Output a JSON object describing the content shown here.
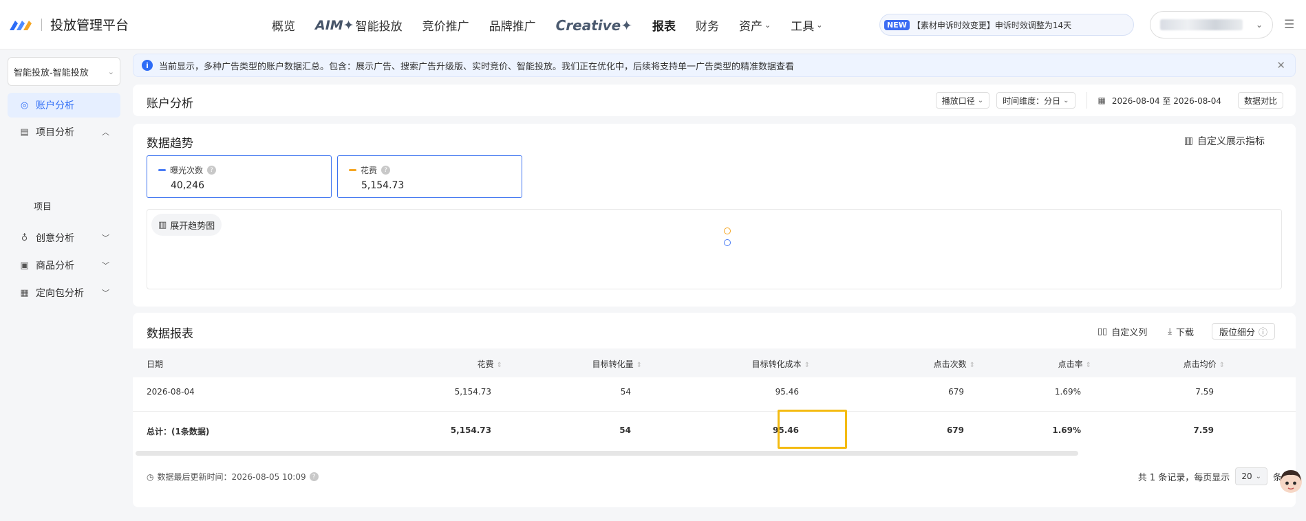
{
  "header": {
    "logo_text": "投放管理平台",
    "nav": [
      {
        "label": "概览"
      },
      {
        "prefix": "AIM✦",
        "label": "智能投放"
      },
      {
        "label": "竞价推广"
      },
      {
        "label": "品牌推广"
      },
      {
        "label": "Creative✦"
      },
      {
        "label": "报表"
      },
      {
        "label": "财务"
      },
      {
        "label": "资产"
      },
      {
        "label": "工具"
      }
    ],
    "notice_badge": "NEW",
    "notice_text": "【素材申诉时效变更】申诉时效调整为14天"
  },
  "sidebar": {
    "account_select": "智能投放-智能投放",
    "items": [
      {
        "label": "账户分析"
      },
      {
        "label": "项目分析"
      },
      {
        "label": "创意分析"
      },
      {
        "label": "商品分析"
      },
      {
        "label": "定向包分析"
      }
    ],
    "sub_item": "项目"
  },
  "banner": {
    "text": "当前显示，多种广告类型的账户数据汇总。包含：展示广告、搜索广告升级版、实时竞价、智能投放。我们正在优化中，后续将支持单一广告类型的精准数据查看"
  },
  "page_header": {
    "title": "账户分析",
    "caliber": "播放口径",
    "time_dim": "时间维度：分日",
    "date_range": "2026-08-04 至 2026-08-04",
    "compare": "数据对比"
  },
  "trend": {
    "title": "数据趋势",
    "custom_metrics": "自定义展示指标",
    "metrics": [
      {
        "label": "曝光次数",
        "value": "40,246",
        "color": "#4a7cf5"
      },
      {
        "label": "花费",
        "value": "5,154.73",
        "color": "#f5a623"
      }
    ],
    "expand": "展开趋势图"
  },
  "report": {
    "title": "数据报表",
    "custom_columns": "自定义列",
    "download": "下载",
    "position_breakdown": "版位细分",
    "columns": [
      "日期",
      "花费",
      "目标转化量",
      "目标转化成本",
      "点击次数",
      "点击率",
      "点击均价"
    ],
    "rows": [
      [
        "2026-08-04",
        "5,154.73",
        "54",
        "95.46",
        "679",
        "1.69%",
        "7.59"
      ]
    ],
    "total": [
      "总计：(1条数据)",
      "5,154.73",
      "54",
      "95.46",
      "679",
      "1.69%",
      "7.59"
    ],
    "updated": "数据最后更新时间：2026-08-05 10:09",
    "pagination_prefix": "共 1 条记录，每页显示",
    "page_size": "20",
    "pagination_suffix": "条"
  }
}
